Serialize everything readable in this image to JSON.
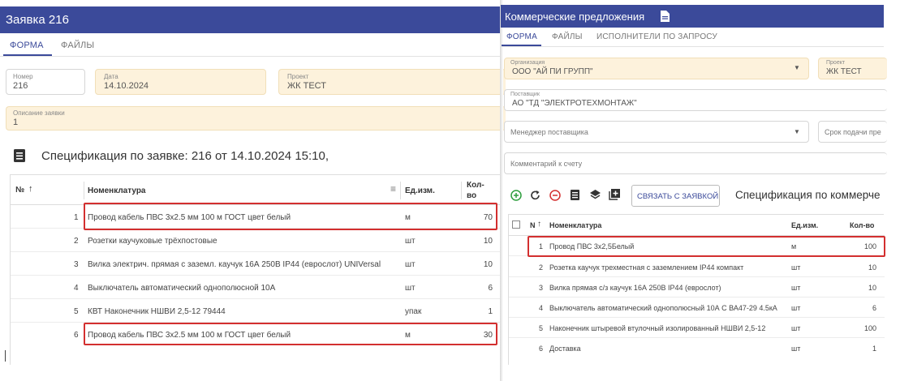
{
  "left": {
    "title": "Заявка 216",
    "tabs": [
      "ФОРМА",
      "ФАЙЛЫ"
    ],
    "fields": {
      "number": {
        "label": "Номер",
        "value": "216"
      },
      "date": {
        "label": "Дата",
        "value": "14.10.2024"
      },
      "project": {
        "label": "Проект",
        "value": "ЖК ТЕСТ"
      },
      "description": {
        "label": "Описание заявки",
        "value": "1"
      }
    },
    "spec_title": "Спецификация по заявке: 216 от 14.10.2024 15:10,",
    "columns": {
      "num": "№",
      "name": "Номенклатура",
      "unit": "Ед.изм.",
      "qty": "Кол-во"
    },
    "rows": [
      {
        "n": "1",
        "name": "Провод кабель ПВС 3х2.5 мм 100 м ГОСТ цвет белый",
        "unit": "м",
        "qty": "70"
      },
      {
        "n": "2",
        "name": "Розетки каучуковые трёхпостовые",
        "unit": "шт",
        "qty": "10"
      },
      {
        "n": "3",
        "name": "Вилка электрич. прямая с заземл. каучук 16А 250В IP44 (еврослот) UNIVersal",
        "unit": "шт",
        "qty": "10"
      },
      {
        "n": "4",
        "name": "Выключатель автоматический однополюсной 10А",
        "unit": "шт",
        "qty": "6"
      },
      {
        "n": "5",
        "name": "КВТ Наконечник НШВИ 2,5-12 79444",
        "unit": "упак",
        "qty": "1"
      },
      {
        "n": "6",
        "name": "Провод кабель ПВС 3х2.5 мм 100 м ГОСТ цвет белый",
        "unit": "м",
        "qty": "30"
      }
    ]
  },
  "right": {
    "title": "Коммерческие предложения",
    "tabs": [
      "ФОРМА",
      "ФАЙЛЫ",
      "ИСПОЛНИТЕЛИ ПО ЗАПРОСУ"
    ],
    "fields": {
      "org": {
        "label": "Организация",
        "value": "ООО \"АЙ ПИ ГРУПП\""
      },
      "project": {
        "label": "Проект",
        "value": "ЖК ТЕСТ"
      },
      "supplier": {
        "label": "Поставщик",
        "value": "АО \"ТД \"ЭЛЕКТРОТЕХМОНТАЖ\""
      },
      "manager": {
        "placeholder": "Менеджер поставщика"
      },
      "deadline": {
        "placeholder": "Срок подачи пре"
      },
      "comment": {
        "placeholder": "Комментарий к счету"
      }
    },
    "link_button": "СВЯЗАТЬ С ЗАЯВКОЙ",
    "spec_title": "Спецификация по коммерче",
    "columns": {
      "num": "N",
      "name": "Номенклатура",
      "unit": "Ед.изм.",
      "qty": "Кол-во"
    },
    "rows": [
      {
        "n": "1",
        "name": "Провод ПВС 3х2,5Белый",
        "unit": "м",
        "qty": "100"
      },
      {
        "n": "2",
        "name": "Розетка каучук трехместная с заземлением IP44 компакт",
        "unit": "шт",
        "qty": "10"
      },
      {
        "n": "3",
        "name": "Вилка прямая с/з каучук 16А 250В IP44 (еврослот)",
        "unit": "шт",
        "qty": "10"
      },
      {
        "n": "4",
        "name": "Выключатель автоматический однополюсный 10А С ВА47-29 4.5кА",
        "unit": "шт",
        "qty": "6"
      },
      {
        "n": "5",
        "name": "Наконечник штыревой втулочный изолированный НШВИ 2,5-12",
        "unit": "шт",
        "qty": "100"
      },
      {
        "n": "6",
        "name": "Доставка",
        "unit": "шт",
        "qty": "1"
      }
    ]
  }
}
